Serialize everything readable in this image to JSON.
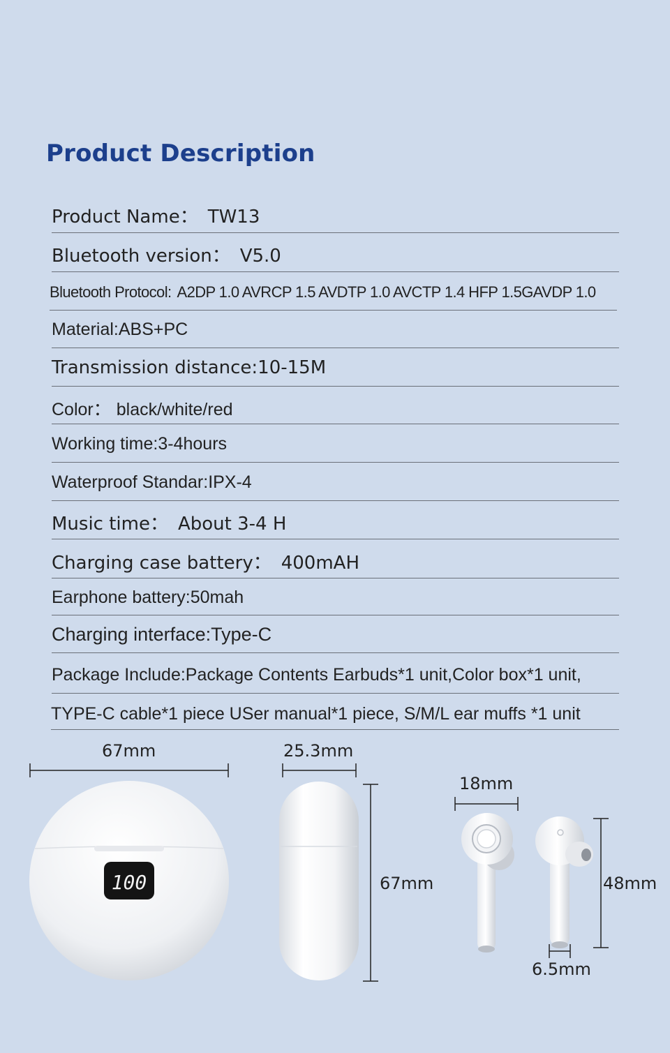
{
  "section_title": "Product Description",
  "specs": [
    {
      "label": "Product Name：",
      "value": "TW13"
    },
    {
      "label": "Bluetooth version：",
      "value": "V5.0"
    },
    {
      "label": "Bluetooth Protocol: ",
      "value": "A2DP 1.0 AVRCP 1.5 AVDTP 1.0 AVCTP 1.4 HFP 1.5GAVDP 1.0"
    },
    {
      "label": "Material:",
      "value": "ABS+PC"
    },
    {
      "label": "Transmission distance:",
      "value": "10-15M"
    },
    {
      "label": "Color： ",
      "value": "black/white/red"
    },
    {
      "label": "Working time:",
      "value": "3-4hours"
    },
    {
      "label": "Waterproof Standar:",
      "value": "IPX-4"
    },
    {
      "label": "Music time：",
      "value": "About 3-4 H"
    },
    {
      "label": "Charging case battery：",
      "value": "400mAH"
    },
    {
      "label": "Earphone battery: ",
      "value": "50mah"
    },
    {
      "label": "Charging interface:",
      "value": "Type-C"
    },
    {
      "label": "Package Include:",
      "value": "Package Contents Earbuds*1 unit,Color box*1 unit,"
    },
    {
      "label": "",
      "value": "TYPE-C cable*1 piece USer manual*1 piece, S/M/L ear muffs *1 unit"
    }
  ],
  "dimensions": {
    "case_width": "67mm",
    "case_depth": "25.3mm",
    "case_height": "67mm",
    "earbud_width": "18mm",
    "earbud_height": "48mm",
    "stem_width": "6.5mm"
  },
  "case_display": "100"
}
